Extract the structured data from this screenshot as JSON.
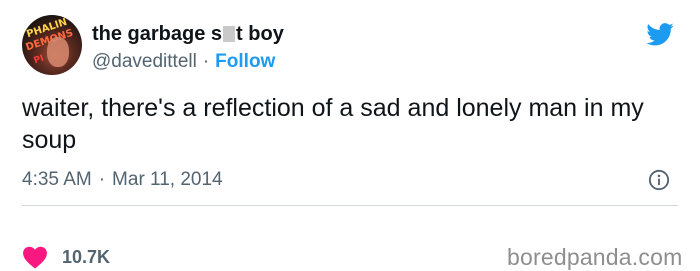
{
  "user": {
    "display_name_start": "the garbage s",
    "display_name_end": "t boy",
    "handle": "@davedittell",
    "separator": "·",
    "follow_label": "Follow"
  },
  "tweet": {
    "text": "waiter, there's a reflection of a sad and lonely man in my soup",
    "time": "4:35 AM",
    "date_separator": "·",
    "date": "Mar 11, 2014"
  },
  "engagement": {
    "likes_count": "10.7K"
  },
  "icons": {
    "brand": "twitter-bird-icon",
    "info": "info-icon",
    "like": "heart-icon"
  },
  "colors": {
    "accent": "#1d9bf0",
    "like": "#f91880",
    "secondary_text": "#536471",
    "divider": "#cfd9de"
  },
  "watermark": "boredpanda.com",
  "avatar_neon_text": [
    "PHALIN",
    "DEMONS",
    "PI"
  ]
}
